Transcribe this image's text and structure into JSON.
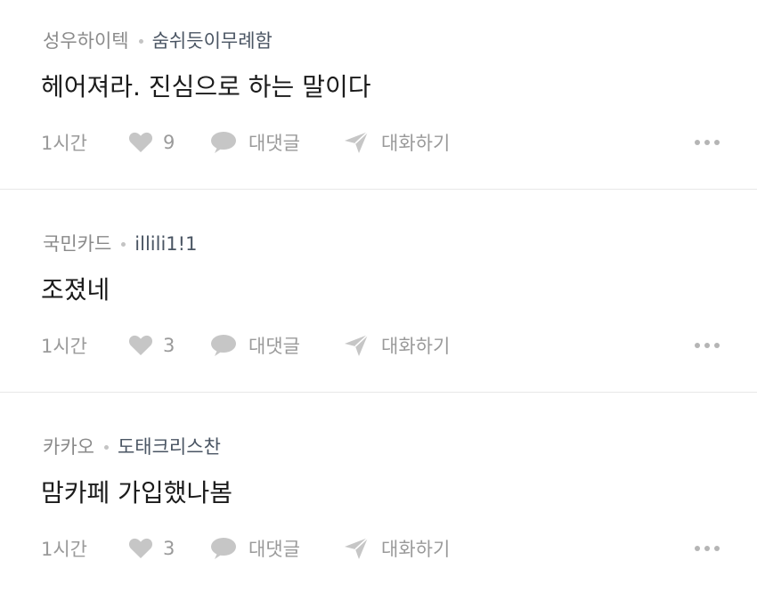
{
  "comments": [
    {
      "company": "성우하이텍",
      "nickname": "숨쉬듯이무례함",
      "text": "헤어져라. 진심으로 하는 말이다",
      "time": "1시간",
      "likes": "9",
      "reply_label": "대댓글",
      "chat_label": "대화하기"
    },
    {
      "company": "국민카드",
      "nickname": "illili1!1",
      "text": "조졌네",
      "time": "1시간",
      "likes": "3",
      "reply_label": "대댓글",
      "chat_label": "대화하기"
    },
    {
      "company": "카카오",
      "nickname": "도태크리스찬",
      "text": "맘카페 가입했나봄",
      "time": "1시간",
      "likes": "3",
      "reply_label": "대댓글",
      "chat_label": "대화하기"
    }
  ],
  "icons": {
    "like": "heart-icon",
    "reply": "speech-bubble-icon",
    "chat": "paper-plane-icon",
    "more": "more-dots-icon"
  },
  "colors": {
    "company": "#8a8a8a",
    "nickname": "#4a5563",
    "body": "#1b1b1b",
    "meta_actions": "#9a9a9a",
    "icon_fill": "#c6c6c6",
    "divider": "#e7e7e7"
  }
}
